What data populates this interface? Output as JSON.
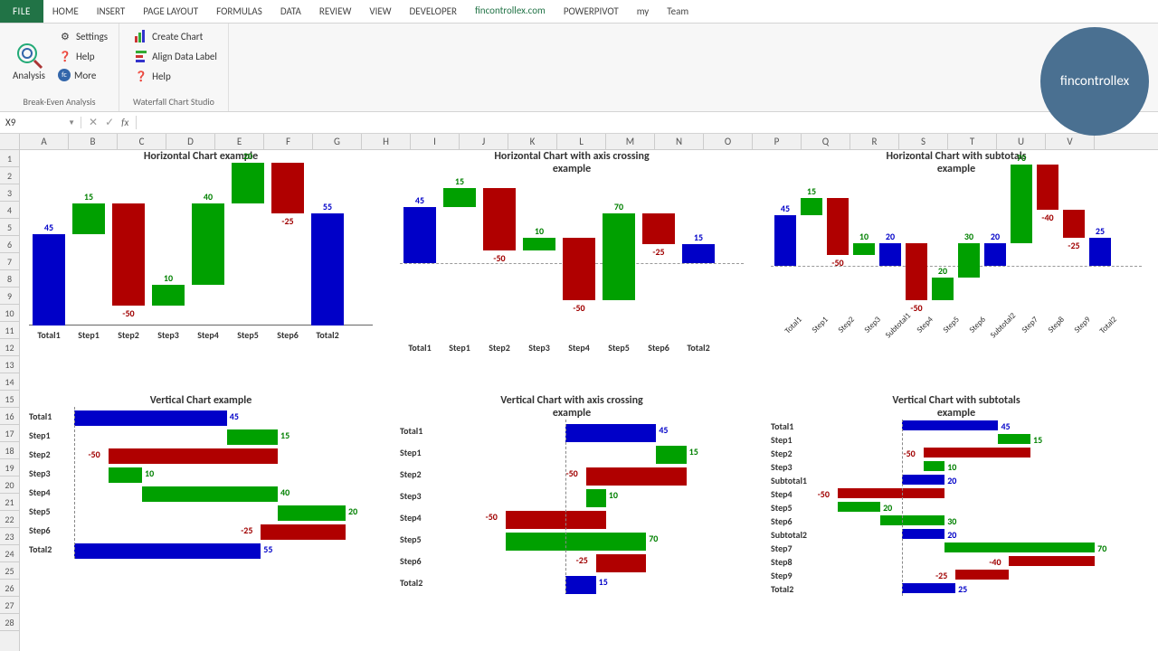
{
  "tabs": [
    "FILE",
    "HOME",
    "INSERT",
    "PAGE LAYOUT",
    "FORMULAS",
    "DATA",
    "REVIEW",
    "VIEW",
    "DEVELOPER",
    "fincontrollex.com",
    "POWERPIVOT",
    "my",
    "Team"
  ],
  "active_tab": "fincontrollex.com",
  "ribbon": {
    "group1": {
      "label": "Break-Even Analysis",
      "big": "Analysis",
      "items": [
        "Settings",
        "Help",
        "More"
      ]
    },
    "group2": {
      "label": "Waterfall Chart Studio",
      "items": [
        "Create Chart",
        "Align Data Label",
        "Help"
      ]
    }
  },
  "brand": "fincontrollex",
  "namebox": "X9",
  "fx": "fx",
  "columns": [
    "A",
    "B",
    "C",
    "D",
    "E",
    "F",
    "G",
    "H",
    "I",
    "J",
    "K",
    "L",
    "M",
    "N",
    "O",
    "P",
    "Q",
    "R",
    "S",
    "T",
    "U",
    "V"
  ],
  "rows_count": 28,
  "chart_data": [
    {
      "id": "h1",
      "type": "waterfall",
      "orientation": "vertical-bars",
      "title": "Horizontal Chart example",
      "categories": [
        "Total1",
        "Step1",
        "Step2",
        "Step3",
        "Step4",
        "Step5",
        "Step6",
        "Total2"
      ],
      "values": [
        45,
        15,
        -50,
        10,
        40,
        20,
        -25,
        55
      ],
      "kinds": [
        "total",
        "pos",
        "neg",
        "pos",
        "pos",
        "pos",
        "neg",
        "total"
      ],
      "ymax": 80
    },
    {
      "id": "h2",
      "type": "waterfall",
      "orientation": "vertical-bars",
      "title": "Horizontal Chart with axis crossing\nexample",
      "categories": [
        "Total1",
        "Step1",
        "Step2",
        "Step3",
        "Step4",
        "Step5",
        "Step6",
        "Total2"
      ],
      "values": [
        45,
        15,
        -50,
        10,
        -50,
        70,
        -25,
        15
      ],
      "kinds": [
        "total",
        "pos",
        "neg",
        "pos",
        "neg",
        "pos",
        "neg",
        "total"
      ],
      "ymin": -60,
      "ymax": 70
    },
    {
      "id": "h3",
      "type": "waterfall",
      "orientation": "vertical-bars",
      "title": "Horizontal Chart with subtotals\nexample",
      "categories": [
        "Total1",
        "Step1",
        "Step2",
        "Step3",
        "Subtotal1",
        "Step4",
        "Step5",
        "Step6",
        "Subtotal2",
        "Step7",
        "Step8",
        "Step9",
        "Total2"
      ],
      "values": [
        45,
        15,
        -50,
        10,
        20,
        -50,
        20,
        30,
        20,
        70,
        -40,
        -25,
        25
      ],
      "kinds": [
        "total",
        "pos",
        "neg",
        "pos",
        "total",
        "neg",
        "pos",
        "pos",
        "total",
        "pos",
        "neg",
        "neg",
        "total"
      ],
      "ymin": -40,
      "ymax": 80
    },
    {
      "id": "v1",
      "type": "waterfall",
      "orientation": "horizontal-bars",
      "title": "Vertical Chart example",
      "categories": [
        "Total1",
        "Step1",
        "Step2",
        "Step3",
        "Step4",
        "Step5",
        "Step6",
        "Total2"
      ],
      "values": [
        45,
        15,
        -50,
        10,
        40,
        20,
        -25,
        55
      ],
      "kinds": [
        "total",
        "pos",
        "neg",
        "pos",
        "pos",
        "pos",
        "neg",
        "total"
      ],
      "xmax": 80
    },
    {
      "id": "v2",
      "type": "waterfall",
      "orientation": "horizontal-bars",
      "title": "Vertical Chart with axis crossing\nexample",
      "categories": [
        "Total1",
        "Step1",
        "Step2",
        "Step3",
        "Step4",
        "Step5",
        "Step6",
        "Total2"
      ],
      "values": [
        45,
        15,
        -50,
        10,
        -50,
        70,
        -25,
        15
      ],
      "kinds": [
        "total",
        "pos",
        "neg",
        "pos",
        "neg",
        "pos",
        "neg",
        "total"
      ],
      "xmin": -60,
      "xmax": 75
    },
    {
      "id": "v3",
      "type": "waterfall",
      "orientation": "horizontal-bars",
      "title": "Vertical Chart with subtotals\nexample",
      "categories": [
        "Total1",
        "Step1",
        "Step2",
        "Step3",
        "Subtotal1",
        "Step4",
        "Step5",
        "Step6",
        "Subtotal2",
        "Step7",
        "Step8",
        "Step9",
        "Total2"
      ],
      "values": [
        45,
        15,
        -50,
        10,
        20,
        -50,
        20,
        30,
        20,
        70,
        -40,
        -25,
        25
      ],
      "kinds": [
        "total",
        "pos",
        "neg",
        "pos",
        "total",
        "neg",
        "pos",
        "pos",
        "total",
        "pos",
        "neg",
        "neg",
        "total"
      ],
      "xmin": -40,
      "xmax": 95
    }
  ]
}
